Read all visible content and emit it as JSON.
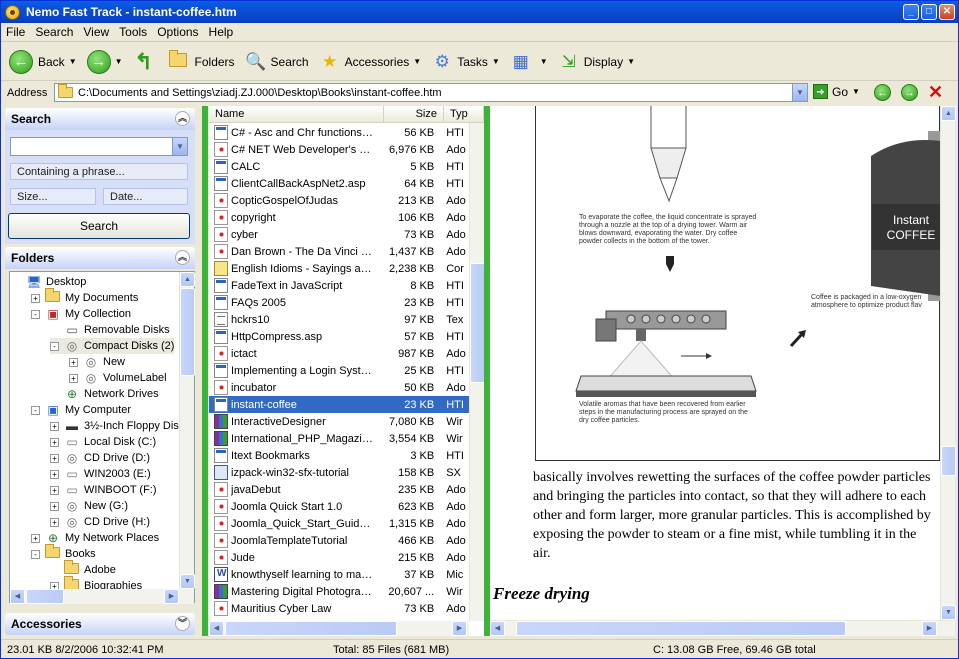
{
  "window": {
    "title": "Nemo Fast Track - instant-coffee.htm"
  },
  "menu": [
    "File",
    "Search",
    "View",
    "Tools",
    "Options",
    "Help"
  ],
  "toolbar": {
    "back": "Back",
    "folders": "Folders",
    "search": "Search",
    "accessories": "Accessories",
    "tasks": "Tasks",
    "display": "Display"
  },
  "address": {
    "label": "Address",
    "value": "C:\\Documents and Settings\\ziadj.ZJ.000\\Desktop\\Books\\instant-coffee.htm",
    "go": "Go"
  },
  "search_panel": {
    "title": "Search",
    "containing": "Containing a phrase...",
    "size": "Size...",
    "date": "Date...",
    "button": "Search"
  },
  "folders_panel": {
    "title": "Folders",
    "items": [
      {
        "label": "Desktop",
        "level": 0,
        "exp": "",
        "icon": "desktop"
      },
      {
        "label": "My Documents",
        "level": 1,
        "exp": "+",
        "icon": "folder"
      },
      {
        "label": "My Collection",
        "level": 1,
        "exp": "-",
        "icon": "collection"
      },
      {
        "label": "Removable Disks",
        "level": 2,
        "exp": "",
        "icon": "removable"
      },
      {
        "label": "Compact Disks (2)",
        "level": 2,
        "exp": "-",
        "icon": "cd",
        "selected": true
      },
      {
        "label": "New",
        "level": 3,
        "exp": "+",
        "icon": "cd"
      },
      {
        "label": "VolumeLabel",
        "level": 3,
        "exp": "+",
        "icon": "cd"
      },
      {
        "label": "Network Drives",
        "level": 2,
        "exp": "",
        "icon": "network"
      },
      {
        "label": "My Computer",
        "level": 1,
        "exp": "-",
        "icon": "computer"
      },
      {
        "label": "3½-Inch Floppy Disk (A:)",
        "level": 2,
        "exp": "+",
        "icon": "floppy"
      },
      {
        "label": "Local Disk (C:)",
        "level": 2,
        "exp": "+",
        "icon": "drive"
      },
      {
        "label": "CD Drive (D:)",
        "level": 2,
        "exp": "+",
        "icon": "cd"
      },
      {
        "label": "WIN2003 (E:)",
        "level": 2,
        "exp": "+",
        "icon": "drive"
      },
      {
        "label": "WINBOOT (F:)",
        "level": 2,
        "exp": "+",
        "icon": "drive"
      },
      {
        "label": "New (G:)",
        "level": 2,
        "exp": "+",
        "icon": "cd"
      },
      {
        "label": "CD Drive (H:)",
        "level": 2,
        "exp": "+",
        "icon": "cd"
      },
      {
        "label": "My Network Places",
        "level": 1,
        "exp": "+",
        "icon": "network"
      },
      {
        "label": "Books",
        "level": 1,
        "exp": "-",
        "icon": "folder"
      },
      {
        "label": "Adobe",
        "level": 2,
        "exp": "",
        "icon": "folder"
      },
      {
        "label": "Biographies",
        "level": 2,
        "exp": "+",
        "icon": "folder"
      }
    ]
  },
  "accessories_panel": {
    "title": "Accessories"
  },
  "file_list": {
    "columns": {
      "name": "Name",
      "size": "Size",
      "type": "Typ"
    },
    "rows": [
      {
        "name": "C# - Asc and Chr functions -...",
        "size": "56 KB",
        "type": "HTI",
        "icon": "htm"
      },
      {
        "name": "C# NET Web Developer's G...",
        "size": "6,976 KB",
        "type": "Ado",
        "icon": "pdf"
      },
      {
        "name": "CALC",
        "size": "5 KB",
        "type": "HTI",
        "icon": "htm"
      },
      {
        "name": "ClientCallBackAspNet2.asp",
        "size": "64 KB",
        "type": "HTI",
        "icon": "htm"
      },
      {
        "name": "CopticGospelOfJudas",
        "size": "213 KB",
        "type": "Ado",
        "icon": "pdf"
      },
      {
        "name": "copyright",
        "size": "106 KB",
        "type": "Ado",
        "icon": "pdf"
      },
      {
        "name": "cyber",
        "size": "73 KB",
        "type": "Ado",
        "icon": "pdf"
      },
      {
        "name": "Dan Brown - The Da Vinci C...",
        "size": "1,437 KB",
        "type": "Ado",
        "icon": "pdf"
      },
      {
        "name": "English Idioms - Sayings and...",
        "size": "2,238 KB",
        "type": "Cor",
        "icon": "chm"
      },
      {
        "name": "FadeText in JavaScript",
        "size": "8 KB",
        "type": "HTI",
        "icon": "htm"
      },
      {
        "name": "FAQs 2005",
        "size": "23 KB",
        "type": "HTI",
        "icon": "htm"
      },
      {
        "name": "hckrs10",
        "size": "97 KB",
        "type": "Tex",
        "icon": "txt"
      },
      {
        "name": "HttpCompress.asp",
        "size": "57 KB",
        "type": "HTI",
        "icon": "htm"
      },
      {
        "name": "ictact",
        "size": "987 KB",
        "type": "Ado",
        "icon": "pdf"
      },
      {
        "name": "Implementing a Login Syste...",
        "size": "25 KB",
        "type": "HTI",
        "icon": "htm"
      },
      {
        "name": "incubator",
        "size": "50 KB",
        "type": "Ado",
        "icon": "pdf"
      },
      {
        "name": "instant-coffee",
        "size": "23 KB",
        "type": "HTI",
        "icon": "htm",
        "selected": true
      },
      {
        "name": "InteractiveDesigner",
        "size": "7,080 KB",
        "type": "Wir",
        "icon": "rar"
      },
      {
        "name": "International_PHP_Magazine",
        "size": "3,554 KB",
        "type": "Wir",
        "icon": "rar"
      },
      {
        "name": "Itext Bookmarks",
        "size": "3 KB",
        "type": "HTI",
        "icon": "htm"
      },
      {
        "name": "izpack-win32-sfx-tutorial",
        "size": "158 KB",
        "type": "SX",
        "icon": "exe"
      },
      {
        "name": "javaDebut",
        "size": "235 KB",
        "type": "Ado",
        "icon": "pdf"
      },
      {
        "name": "Joomla Quick Start 1.0",
        "size": "623 KB",
        "type": "Ado",
        "icon": "pdf"
      },
      {
        "name": "Joomla_Quick_Start_Guide_...",
        "size": "1,315 KB",
        "type": "Ado",
        "icon": "pdf"
      },
      {
        "name": "JoomlaTemplateTutorial",
        "size": "466 KB",
        "type": "Ado",
        "icon": "pdf"
      },
      {
        "name": "Jude",
        "size": "215 KB",
        "type": "Ado",
        "icon": "pdf"
      },
      {
        "name": "knowthyself learning to mak...",
        "size": "37 KB",
        "type": "Mic",
        "icon": "doc"
      },
      {
        "name": "Mastering Digital Photograp...",
        "size": "20,607 ...",
        "type": "Wir",
        "icon": "rar"
      },
      {
        "name": "Mauritius Cyber Law",
        "size": "73 KB",
        "type": "Ado",
        "icon": "pdf"
      }
    ]
  },
  "preview": {
    "caption_top": "To evaporate the coffee, the liquid concentrate is sprayed through a nozzle at the top of a drying tower. Warm air blows downward, evaporating the water. Dry coffee powder collects in the bottom of the tower.",
    "caption_right": "Coffee is packaged in a low-oxygen atmosphere to optimize product flav",
    "caption_bottom": "Volatile aromas that have been recovered from earlier steps in the manufacturing process are sprayed on the dry coffee particles.",
    "jar_line1": "Instant",
    "jar_line2": "COFFEE",
    "body": "basically involves rewetting the surfaces of the coffee powder particles and bringing the particles into contact, so that they will adhere to each other and form larger, more granular particles. This is accomplished by exposing the powder to steam or a fine mist, while tumbling it in the air.",
    "heading": "Freeze drying"
  },
  "status": {
    "left": "23.01 KB   8/2/2006 10:32:41 PM",
    "center": "Total: 85 Files (681 MB)",
    "right": "C: 13.08 GB Free, 69.46 GB total"
  }
}
